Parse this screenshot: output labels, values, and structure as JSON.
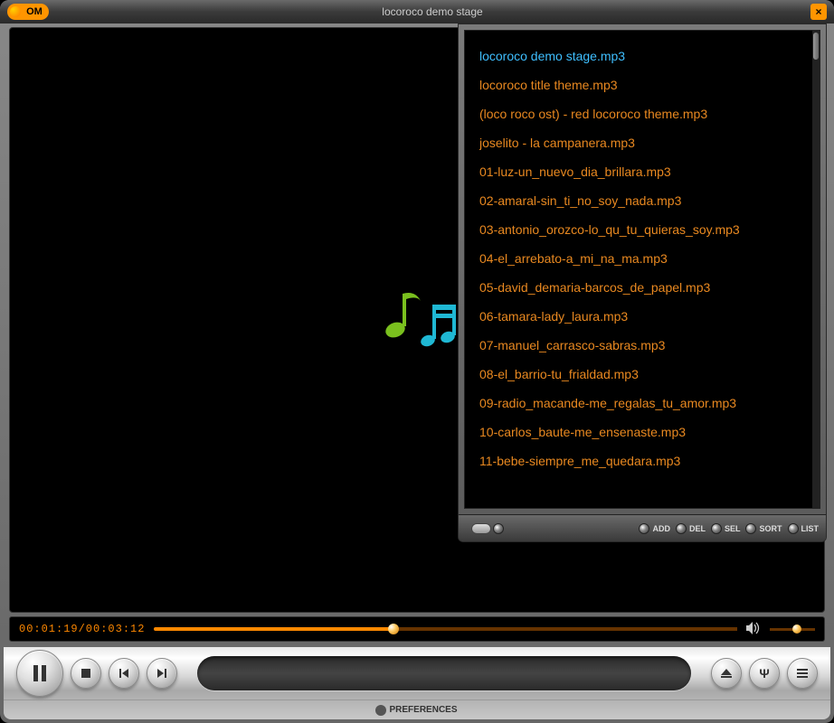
{
  "app": {
    "logo_text": "OM",
    "title": "locoroco demo stage",
    "close_glyph": "×"
  },
  "playlist": {
    "items": [
      "locoroco demo stage.mp3",
      "locoroco title theme.mp3",
      "(loco roco ost) - red locoroco theme.mp3",
      "joselito - la campanera.mp3",
      "01-luz-un_nuevo_dia_brillara.mp3",
      "02-amaral-sin_ti_no_soy_nada.mp3",
      "03-antonio_orozco-lo_qu_tu_quieras_soy.mp3",
      "04-el_arrebato-a_mi_na_ma.mp3",
      "05-david_demaria-barcos_de_papel.mp3",
      "06-tamara-lady_laura.mp3",
      "07-manuel_carrasco-sabras.mp3",
      "08-el_barrio-tu_frialdad.mp3",
      "09-radio_macande-me_regalas_tu_amor.mp3",
      "10-carlos_baute-me_ensenaste.mp3",
      "11-bebe-siempre_me_quedara.mp3"
    ],
    "active_index": 0,
    "buttons": {
      "add": "ADD",
      "del": "DEL",
      "sel": "SEL",
      "sort": "SORT",
      "list": "LIST"
    }
  },
  "playback": {
    "time_display": "00:01:19/00:03:12",
    "progress_percent": 41,
    "volume_percent": 60
  },
  "footer": {
    "preferences_label": "PREFERENCES"
  }
}
